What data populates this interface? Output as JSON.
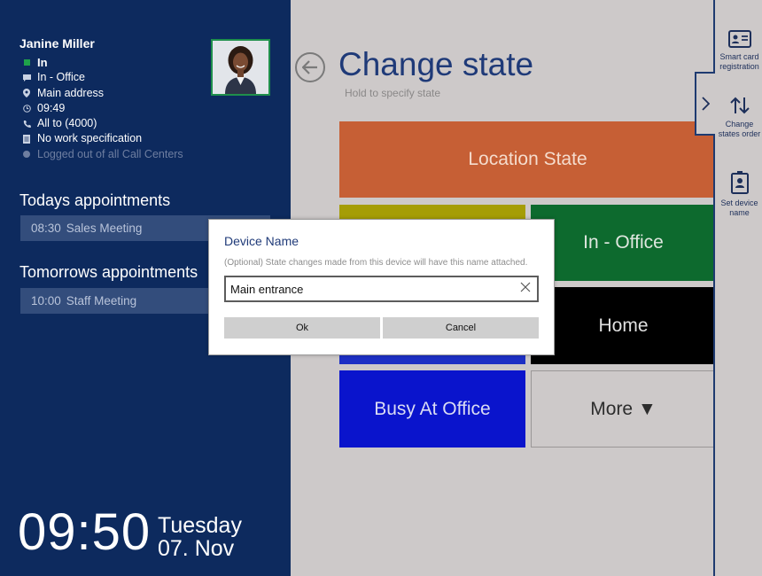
{
  "user": {
    "name": "Janine Miller",
    "status_items": [
      {
        "icon": "status-square-icon",
        "text": "In"
      },
      {
        "icon": "comment-icon",
        "text": "In - Office"
      },
      {
        "icon": "location-pin-icon",
        "text": "Main address"
      },
      {
        "icon": "clock-icon",
        "text": "09:49"
      },
      {
        "icon": "phone-icon",
        "text": "All to (4000)"
      },
      {
        "icon": "document-icon",
        "text": "No work specification"
      },
      {
        "icon": "circle-icon",
        "text": "Logged out of all Call Centers"
      }
    ]
  },
  "appointments": {
    "today_title": "Todays appointments",
    "today": [
      {
        "time": "08:30",
        "title": "Sales Meeting"
      }
    ],
    "tomorrow_title": "Tomorrows appointments",
    "tomorrow": [
      {
        "time": "10:00",
        "title": "Staff Meeting"
      }
    ]
  },
  "clock": {
    "time": "09:50",
    "weekday": "Tuesday",
    "date": "07. Nov"
  },
  "main": {
    "title": "Change state",
    "hint": "Hold to specify state",
    "tiles": {
      "location": "Location State",
      "in_office": "In - Office",
      "home": "Home",
      "busy": "Busy At Office",
      "more": "More ▼"
    }
  },
  "rightbar": {
    "smart_card": "Smart card registration",
    "change_order": "Change states order",
    "device_name": "Set device name"
  },
  "dialog": {
    "title": "Device Name",
    "description": "(Optional) State changes made from this device will have this name attached.",
    "input_value": "Main entrance",
    "ok": "Ok",
    "cancel": "Cancel"
  },
  "colors": {
    "left_panel": "#0d2a5e",
    "accent": "#1f3a78",
    "location_tile": "#c65f35",
    "in_office_tile": "#0d6a2e",
    "busy_tile": "#0a14cc"
  }
}
